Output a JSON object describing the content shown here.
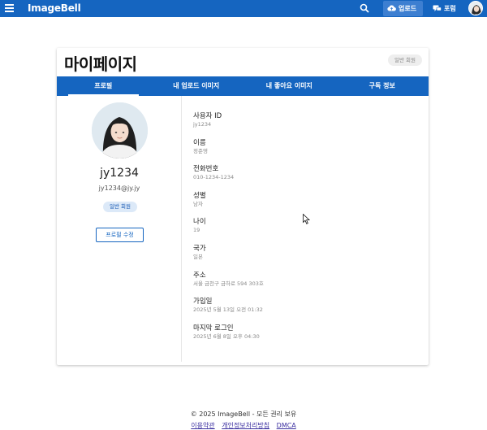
{
  "nav": {
    "brand": "ImageBell",
    "upload_label": "업로드",
    "forum_label": "포럼"
  },
  "page": {
    "title": "마이페이지",
    "header_badge": "일반 회원"
  },
  "tabs": [
    {
      "label": "프로필",
      "active": true
    },
    {
      "label": "내 업로드 이미지",
      "active": false
    },
    {
      "label": "내 좋아요 이미지",
      "active": false
    },
    {
      "label": "구독 정보",
      "active": false
    }
  ],
  "profile": {
    "username": "jy1234",
    "email": "jy1234@jy.jy",
    "badge": "일반 회원",
    "edit_label": "프로필 수정"
  },
  "fields": [
    {
      "label": "사용자 ID",
      "value": "jy1234"
    },
    {
      "label": "이름",
      "value": "정준영"
    },
    {
      "label": "전화번호",
      "value": "010-1234-1234"
    },
    {
      "label": "성별",
      "value": "남자"
    },
    {
      "label": "나이",
      "value": "19"
    },
    {
      "label": "국가",
      "value": "일본"
    },
    {
      "label": "주소",
      "value": "서울 금천구 금하로 594 303호"
    },
    {
      "label": "가입일",
      "value": "2025년 5월 13일 오전 01:32"
    },
    {
      "label": "마지막 로그인",
      "value": "2025년 6월 8일 오후 04:30"
    }
  ],
  "footer": {
    "copyright": "© 2025 ImageBell - 모든 권리 보유",
    "links": [
      "이용약관",
      "개인정보처리방침",
      "DMCA"
    ]
  },
  "colors": {
    "primary": "#1565c0",
    "badge_bg": "#dce9f8"
  }
}
